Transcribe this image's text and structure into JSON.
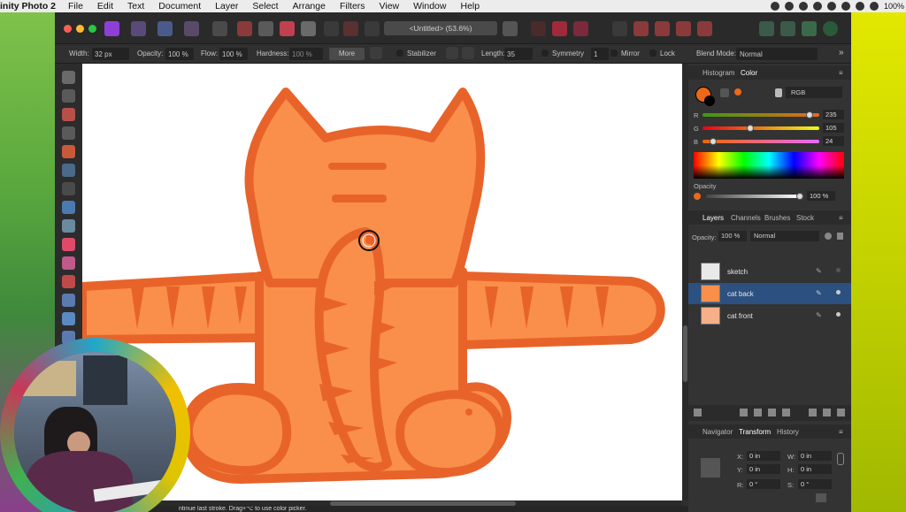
{
  "menubar": {
    "app": "inity Photo 2",
    "items": [
      "File",
      "Edit",
      "Text",
      "Document",
      "Layer",
      "Select",
      "Arrange",
      "Filters",
      "View",
      "Window",
      "Help"
    ],
    "battery": "100%"
  },
  "toolbar": {
    "doc_title": "<Untitled> (53.6%)"
  },
  "context": {
    "width_label": "Width:",
    "width_value": "32 px",
    "opacity_label": "Opacity:",
    "opacity_value": "100 %",
    "flow_label": "Flow:",
    "flow_value": "100 %",
    "hardness_label": "Hardness:",
    "hardness_value": "100 %",
    "more": "More",
    "stabilizer": "Stabilizer",
    "length_label": "Length:",
    "length_value": "35",
    "symmetry": "Symmetry",
    "symmetry_count": "1",
    "mirror": "Mirror",
    "lock": "Lock",
    "blend_label": "Blend Mode:",
    "blend_value": "Normal"
  },
  "color_panel": {
    "tabs": [
      "Histogram",
      "Color"
    ],
    "model": "RGB",
    "channels": [
      {
        "name": "R",
        "value": "235",
        "level": 0.92
      },
      {
        "name": "G",
        "value": "105",
        "level": 0.41
      },
      {
        "name": "B",
        "value": "24",
        "level": 0.09
      }
    ],
    "opacity_label": "Opacity",
    "opacity_value": "100 %",
    "primary": "#eb6918"
  },
  "layers_panel": {
    "tabs": [
      "Layers",
      "Channels",
      "Brushes",
      "Stock"
    ],
    "opacity_label": "Opacity:",
    "opacity_value": "100 %",
    "blend": "Normal",
    "layers": [
      {
        "name": "sketch",
        "selected": false
      },
      {
        "name": "cat back",
        "selected": true
      },
      {
        "name": "cat front",
        "selected": false
      }
    ]
  },
  "transform_panel": {
    "tabs": [
      "Navigator",
      "Transform",
      "History"
    ],
    "x": "0 in",
    "y": "0 in",
    "w": "0 in",
    "h": "0 in",
    "r": "0 °",
    "s": "0 °",
    "labels": {
      "x": "X:",
      "y": "Y:",
      "w": "W:",
      "h": "H:",
      "r": "R:",
      "s": "S:"
    }
  },
  "status": {
    "text": "ntinue last stroke. Drag+⌥ to use color picker."
  },
  "colors": {
    "accent": "#eb6918",
    "cat_fill": "#f98f4a",
    "cat_stroke": "#e8632a",
    "selected_row": "#2c5180"
  }
}
